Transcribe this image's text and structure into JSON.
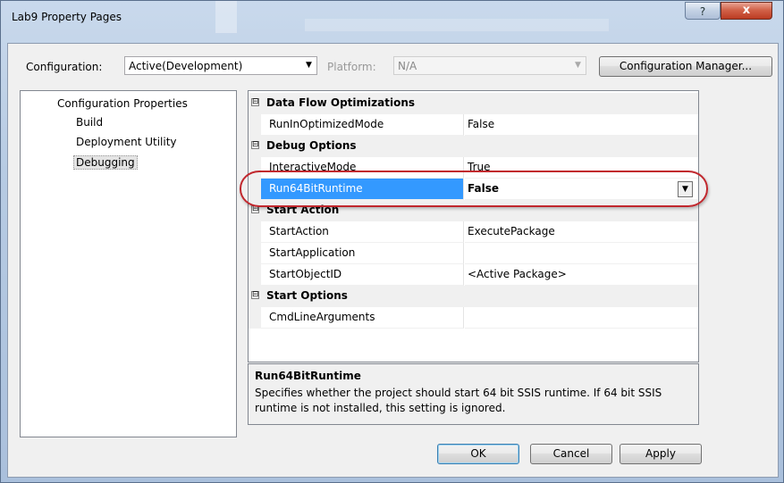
{
  "window": {
    "title": "Lab9 Property Pages",
    "help_glyph": "?",
    "close_glyph": "x"
  },
  "toolbar": {
    "configuration_label": "Configuration:",
    "configuration_value": "Active(Development)",
    "platform_label": "Platform:",
    "platform_value": "N/A",
    "config_manager_label": "Configuration Manager..."
  },
  "tree": {
    "root": "Configuration Properties",
    "items": [
      "Build",
      "Deployment Utility",
      "Debugging"
    ],
    "selected": "Debugging"
  },
  "grid": {
    "categories": [
      {
        "label": "Data Flow Optimizations",
        "expander": "⊟"
      },
      {
        "label": "Debug Options",
        "expander": "⊟"
      },
      {
        "label": "Start Action",
        "expander": "⊟"
      },
      {
        "label": "Start Options",
        "expander": "⊟"
      }
    ],
    "props": {
      "run_in_optimized": {
        "name": "RunInOptimizedMode",
        "value": "False"
      },
      "interactive": {
        "name": "InteractiveMode",
        "value": "True"
      },
      "run64": {
        "name": "Run64BitRuntime",
        "value": "False"
      },
      "start_action": {
        "name": "StartAction",
        "value": "ExecutePackage"
      },
      "start_application": {
        "name": "StartApplication",
        "value": ""
      },
      "start_object": {
        "name": "StartObjectID",
        "value": "<Active Package>"
      },
      "cmd_args": {
        "name": "CmdLineArguments",
        "value": ""
      }
    }
  },
  "description": {
    "title": "Run64BitRuntime",
    "text": "Specifies whether the project should start 64 bit SSIS runtime. If 64 bit SSIS runtime is not installed, this setting is ignored."
  },
  "buttons": {
    "ok": "OK",
    "cancel": "Cancel",
    "apply": "Apply"
  },
  "colors": {
    "selection": "#3399ff",
    "highlight_oval": "#c1272d"
  }
}
